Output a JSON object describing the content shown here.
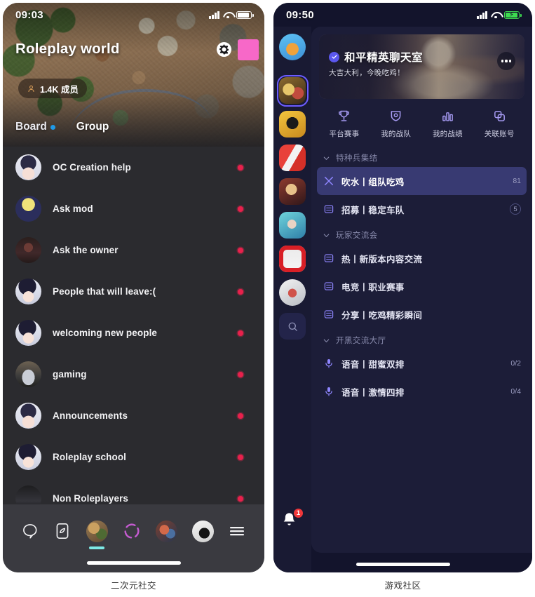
{
  "left_phone": {
    "status": {
      "time": "09:03"
    },
    "hero": {
      "title": "Roleplay world",
      "member_count": "1.4K 成员",
      "settings_icon": "gear-icon",
      "pink_badge": "pink-block"
    },
    "tabs": [
      {
        "label": "Board",
        "active": true,
        "dot": true
      },
      {
        "label": "Group",
        "active": false,
        "dot": false
      }
    ],
    "channels": [
      {
        "name": "OC Creation help",
        "avatar": "anime-girl-white-wings",
        "unread": true
      },
      {
        "name": "Ask mod",
        "avatar": "moon-angel",
        "unread": true
      },
      {
        "name": "Ask the owner",
        "avatar": "dark-knight",
        "unread": true
      },
      {
        "name": "People that will leave:(",
        "avatar": "anime-boy-dark-hair",
        "unread": true
      },
      {
        "name": "welcoming new people",
        "avatar": "anime-boy-dark-hair-2",
        "unread": true
      },
      {
        "name": "gaming",
        "avatar": "sports-car",
        "unread": true
      },
      {
        "name": "Announcements",
        "avatar": "anime-girl-white-wings",
        "unread": true
      },
      {
        "name": "Roleplay school",
        "avatar": "anime-boy-dark-hair",
        "unread": true
      },
      {
        "name": "Non Roleplayers",
        "avatar": "dark-portrait",
        "unread": true
      }
    ],
    "bottom_nav": [
      {
        "icon": "chat-bubble-icon",
        "type": "icon",
        "active": false
      },
      {
        "icon": "compass-card-icon",
        "type": "icon",
        "active": false
      },
      {
        "icon": "world-thumbnail",
        "type": "avatar",
        "active": true
      },
      {
        "icon": "broken-ring-icon",
        "type": "icon",
        "active": false
      },
      {
        "icon": "community-thumbnail",
        "type": "avatar",
        "active": false
      },
      {
        "icon": "cat-profile-avatar",
        "type": "avatar",
        "active": false
      },
      {
        "icon": "menu-hamburger-icon",
        "type": "icon",
        "active": false
      }
    ]
  },
  "right_phone": {
    "status": {
      "time": "09:50"
    },
    "server_rail": [
      {
        "name": "user-avatar-emoji",
        "active": false
      },
      {
        "name": "server-peace-elite",
        "active": true
      },
      {
        "name": "server-brawl-stars",
        "active": false
      },
      {
        "name": "server-red-game",
        "active": false
      },
      {
        "name": "server-hero-game",
        "active": false
      },
      {
        "name": "server-blue-hair-game",
        "active": false
      },
      {
        "name": "server-empire-game",
        "active": false
      },
      {
        "name": "server-circle-game",
        "active": false
      }
    ],
    "rail_search_icon": "search-icon",
    "notification": {
      "icon": "bell-icon",
      "count": "1"
    },
    "banner": {
      "title": "和平精英聊天室",
      "subtitle": "大吉大利，今晚吃鸡！",
      "verified_icon": "verified-check-icon",
      "more_icon": "more-horizontal-icon"
    },
    "actions": [
      {
        "label": "平台赛事",
        "icon": "trophy-icon"
      },
      {
        "label": "我的战队",
        "icon": "shield-icon"
      },
      {
        "label": "我的战绩",
        "icon": "bar-chart-icon"
      },
      {
        "label": "关联账号",
        "icon": "link-copy-icon"
      }
    ],
    "sections": [
      {
        "name": "特种兵集结",
        "collapsed": false,
        "channels": [
          {
            "name": "吹水丨组队吃鸡",
            "icon": "chat-x-icon",
            "badge": "81",
            "badge_style": "plain",
            "active": true
          },
          {
            "name": "招募丨稳定车队",
            "icon": "text-channel-icon",
            "badge": "5",
            "badge_style": "circle",
            "active": false
          }
        ]
      },
      {
        "name": "玩家交流会",
        "collapsed": false,
        "channels": [
          {
            "name": "热丨新版本内容交流",
            "icon": "text-channel-icon",
            "badge": "",
            "badge_style": "none",
            "active": false
          },
          {
            "name": "电竞丨职业赛事",
            "icon": "text-channel-icon",
            "badge": "",
            "badge_style": "none",
            "active": false
          },
          {
            "name": "分享丨吃鸡精彩瞬间",
            "icon": "text-channel-icon",
            "badge": "",
            "badge_style": "none",
            "active": false
          }
        ]
      },
      {
        "name": "开黑交流大厅",
        "collapsed": false,
        "channels": [
          {
            "name": "语音丨甜蜜双排",
            "icon": "microphone-icon",
            "badge": "0/2",
            "badge_style": "plain",
            "active": false
          },
          {
            "name": "语音丨激情四排",
            "icon": "microphone-icon",
            "badge": "0/4",
            "badge_style": "plain",
            "active": false
          }
        ]
      }
    ]
  },
  "captions": {
    "left": "二次元社交",
    "right": "游戏社区"
  },
  "colors": {
    "left_bg": "#2b2b2f",
    "left_bar": "#3a3a40",
    "unread_dot": "#e8214c",
    "tab_dot": "#1f9ae8",
    "nav_active": "#7de9e5",
    "pink": "#f768c8",
    "right_bg": "#13142c",
    "right_rail": "#191a33",
    "right_panel": "#1c1d38",
    "channel_active": "#383a72",
    "accent_purple": "#6c5cff",
    "badge_red": "#f0373a"
  }
}
